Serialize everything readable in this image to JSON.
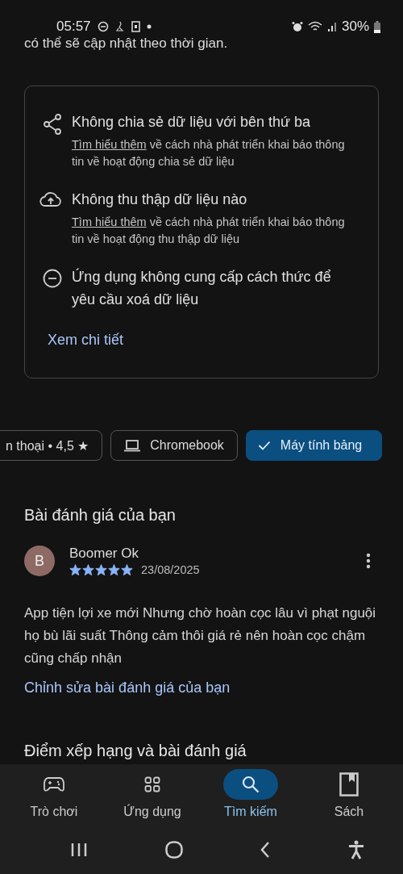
{
  "status_bar": {
    "time": "05:57",
    "battery": "30%"
  },
  "intro_text": "có thể sẽ cập nhật theo thời gian.",
  "data_safety": {
    "items": [
      {
        "kind": "share",
        "title": "Không chia sẻ dữ liệu với bên thứ ba",
        "link": "Tìm hiểu thêm",
        "note": " về cách nhà phát triển khai báo thông tin về hoạt động chia sẻ dữ liệu"
      },
      {
        "kind": "cloud",
        "title": "Không thu thập dữ liệu nào",
        "link": "Tìm hiểu thêm",
        "note": " về cách nhà phát triển khai báo thông tin về hoạt động thu thập dữ liệu"
      },
      {
        "kind": "minus",
        "title": "Ứng dụng không cung cấp cách thức để yêu cầu xoá dữ liệu"
      }
    ],
    "details_link": "Xem chi tiết"
  },
  "device_chips": [
    {
      "kind": "phone",
      "label": "n thoại • 4,5 ★",
      "selected": false
    },
    {
      "kind": "laptop",
      "label": "Chromebook",
      "selected": false
    },
    {
      "kind": "tablet",
      "label": "Máy tính bảng",
      "selected": true
    }
  ],
  "your_review": {
    "heading": "Bài đánh giá của bạn",
    "avatar": "B",
    "author": "Boomer Ok",
    "stars": 5,
    "date": "23/08/2025",
    "text": "App tiện lợi xe mới Nhưng chờ hoàn cọc lâu vì phạt nguội họ bù lãi suất Thông cảm thôi giá rẻ nên hoàn cọc chậm cũng chấp nhận",
    "edit_link": "Chỉnh sửa bài đánh giá của bạn"
  },
  "next_heading": "Điểm xếp hạng và bài đánh giá",
  "bottom_nav": [
    {
      "kind": "games",
      "label": "Trò chơi",
      "selected": false
    },
    {
      "kind": "apps",
      "label": "Ứng dụng",
      "selected": false
    },
    {
      "kind": "search",
      "label": "Tìm kiếm",
      "selected": true
    },
    {
      "kind": "books",
      "label": "Sách",
      "selected": false
    }
  ]
}
